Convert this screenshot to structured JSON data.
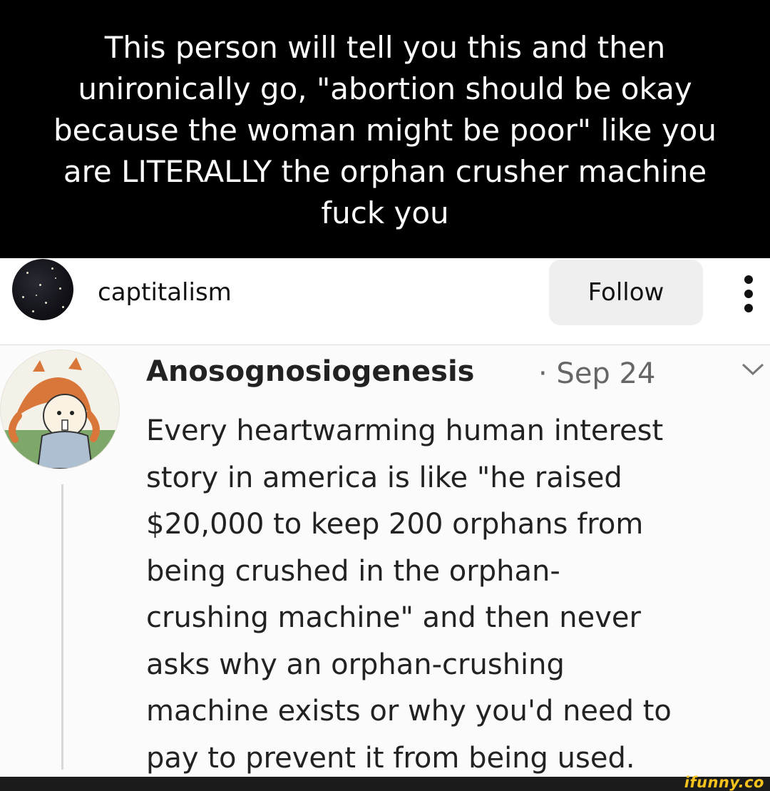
{
  "caption": {
    "text": "This person will tell you this and then\nunironically go, \"abortion should be okay\nbecause the woman might be poor\" like you\nare LITERALLY the orphan crusher machine\nfuck you"
  },
  "account": {
    "username": "captitalism",
    "follow_label": "Follow",
    "avatar_icon": "starry-night-avatar",
    "more_icon": "more-vertical-icon"
  },
  "embedded_post": {
    "author": "Anosognosiogenesis",
    "date": "· Sep 24",
    "body": "Every heartwarming human interest\nstory in america is like \"he raised\n$20,000 to keep 200 orphans from\nbeing crushed in the orphan-\ncrushing machine\" and then never\nasks why an orphan-crushing\nmachine exists or why you'd need to\npay to prevent it from being used.",
    "avatar_icon": "cartoon-girl-avatar",
    "menu_icon": "chevron-down-icon"
  },
  "footer": {
    "watermark": "ifunny.co",
    "watermark_color": "#f7c21c"
  },
  "colors": {
    "caption_bg": "#000000",
    "caption_text": "#ffffff",
    "follow_bg": "#efefef"
  }
}
